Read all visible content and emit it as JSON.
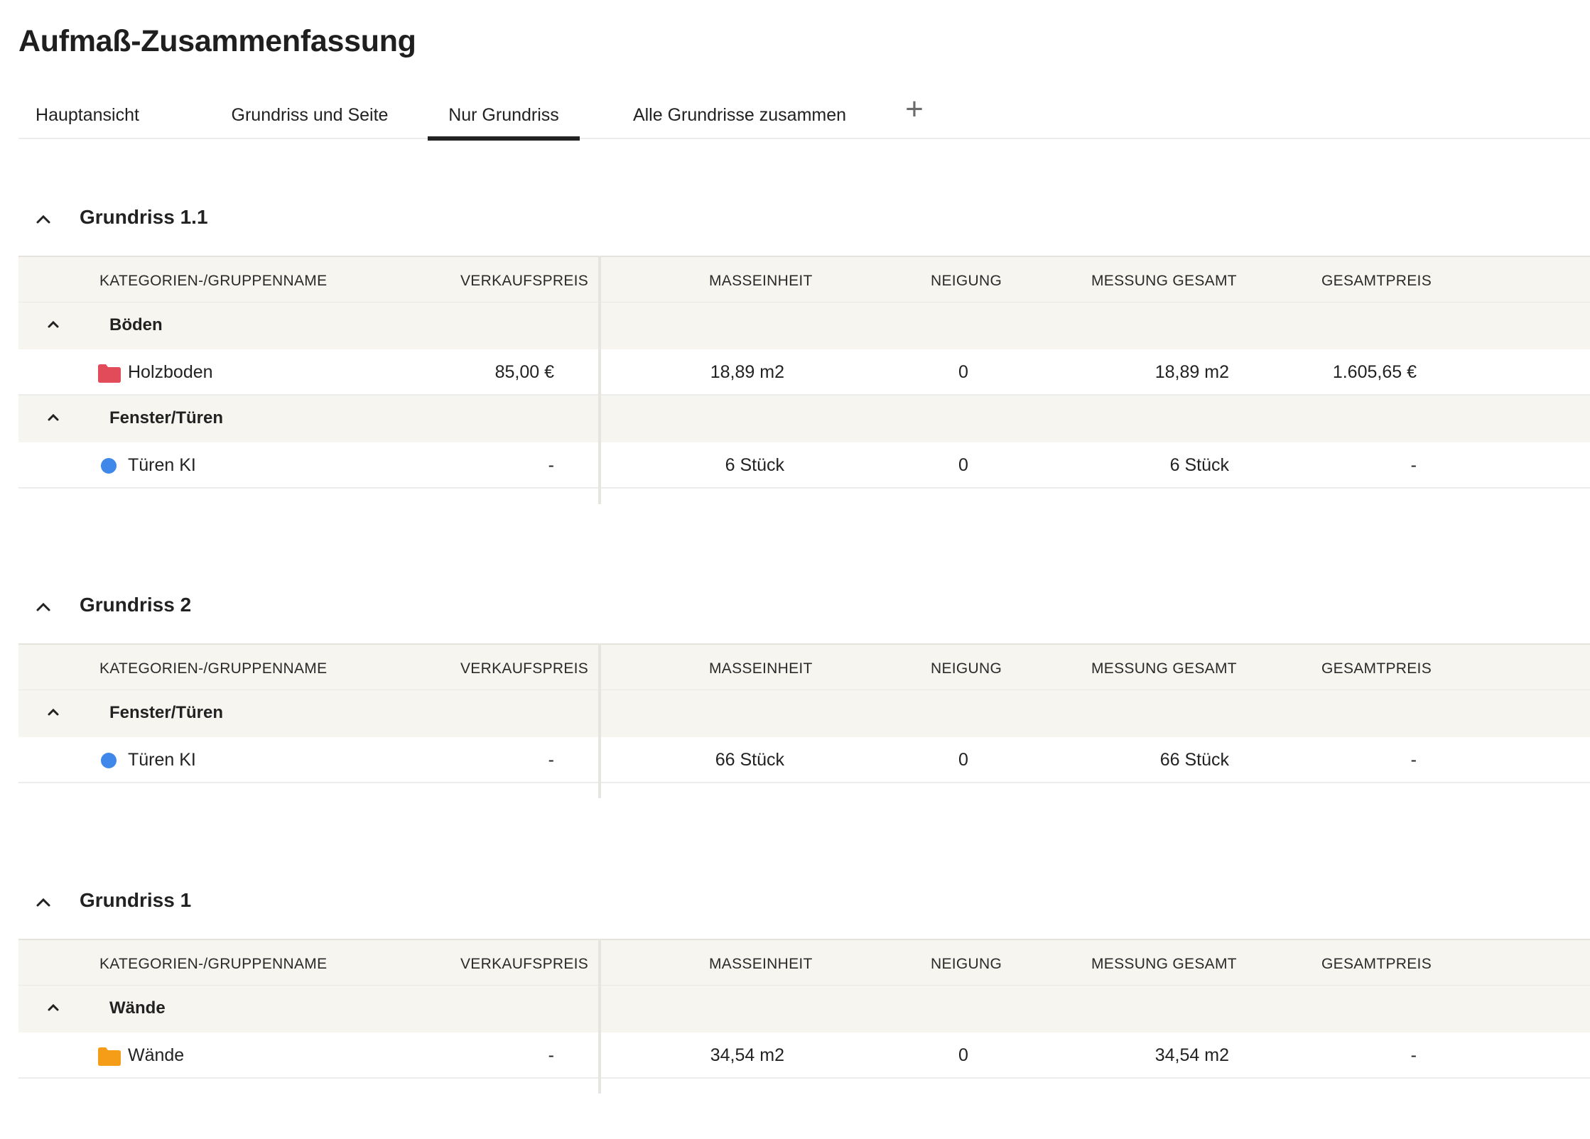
{
  "page": {
    "title": "Aufmaß-Zusammenfassung"
  },
  "tabs": [
    {
      "label": "Hauptansicht",
      "active": false
    },
    {
      "label": "Grundriss und Seite",
      "active": false
    },
    {
      "label": "Nur Grundriss",
      "active": true
    },
    {
      "label": "Alle Grundrisse zusammen",
      "active": false
    }
  ],
  "add_tab_icon": "plus-icon",
  "columns": {
    "name": "KATEGORIEN-/GRUPPENNAME",
    "price": "VERKAUFSPREIS",
    "unit": "MASSEINHEIT",
    "slope": "NEIGUNG",
    "total_measure": "MESSUNG GESAMT",
    "total_price": "GESAMTPREIS"
  },
  "colors": {
    "folder_red": "#e24b5a",
    "dot_blue": "#3f87e8",
    "folder_orange": "#f59c18"
  },
  "sections": [
    {
      "title": "Grundriss 1.1",
      "groups": [
        {
          "name": "Böden",
          "items": [
            {
              "icon": "folder-icon",
              "name": "Holzboden",
              "price": "85,00 €",
              "unit": "18,89 m2",
              "slope": "0",
              "total_measure": "18,89 m2",
              "total_price": "1.605,65 €"
            }
          ]
        },
        {
          "name": "Fenster/Türen",
          "items": [
            {
              "icon": "circle-icon",
              "name": "Türen KI",
              "price": "-",
              "unit": "6 Stück",
              "slope": "0",
              "total_measure": "6 Stück",
              "total_price": "-"
            }
          ]
        }
      ]
    },
    {
      "title": "Grundriss 2",
      "groups": [
        {
          "name": "Fenster/Türen",
          "items": [
            {
              "icon": "circle-icon",
              "name": "Türen KI",
              "price": "-",
              "unit": "66 Stück",
              "slope": "0",
              "total_measure": "66 Stück",
              "total_price": "-"
            }
          ]
        }
      ]
    },
    {
      "title": "Grundriss 1",
      "groups": [
        {
          "name": "Wände",
          "items": [
            {
              "icon": "folder-icon",
              "name": "Wände",
              "price": "-",
              "unit": "34,54 m2",
              "slope": "0",
              "total_measure": "34,54 m2",
              "total_price": "-"
            }
          ]
        }
      ]
    }
  ]
}
